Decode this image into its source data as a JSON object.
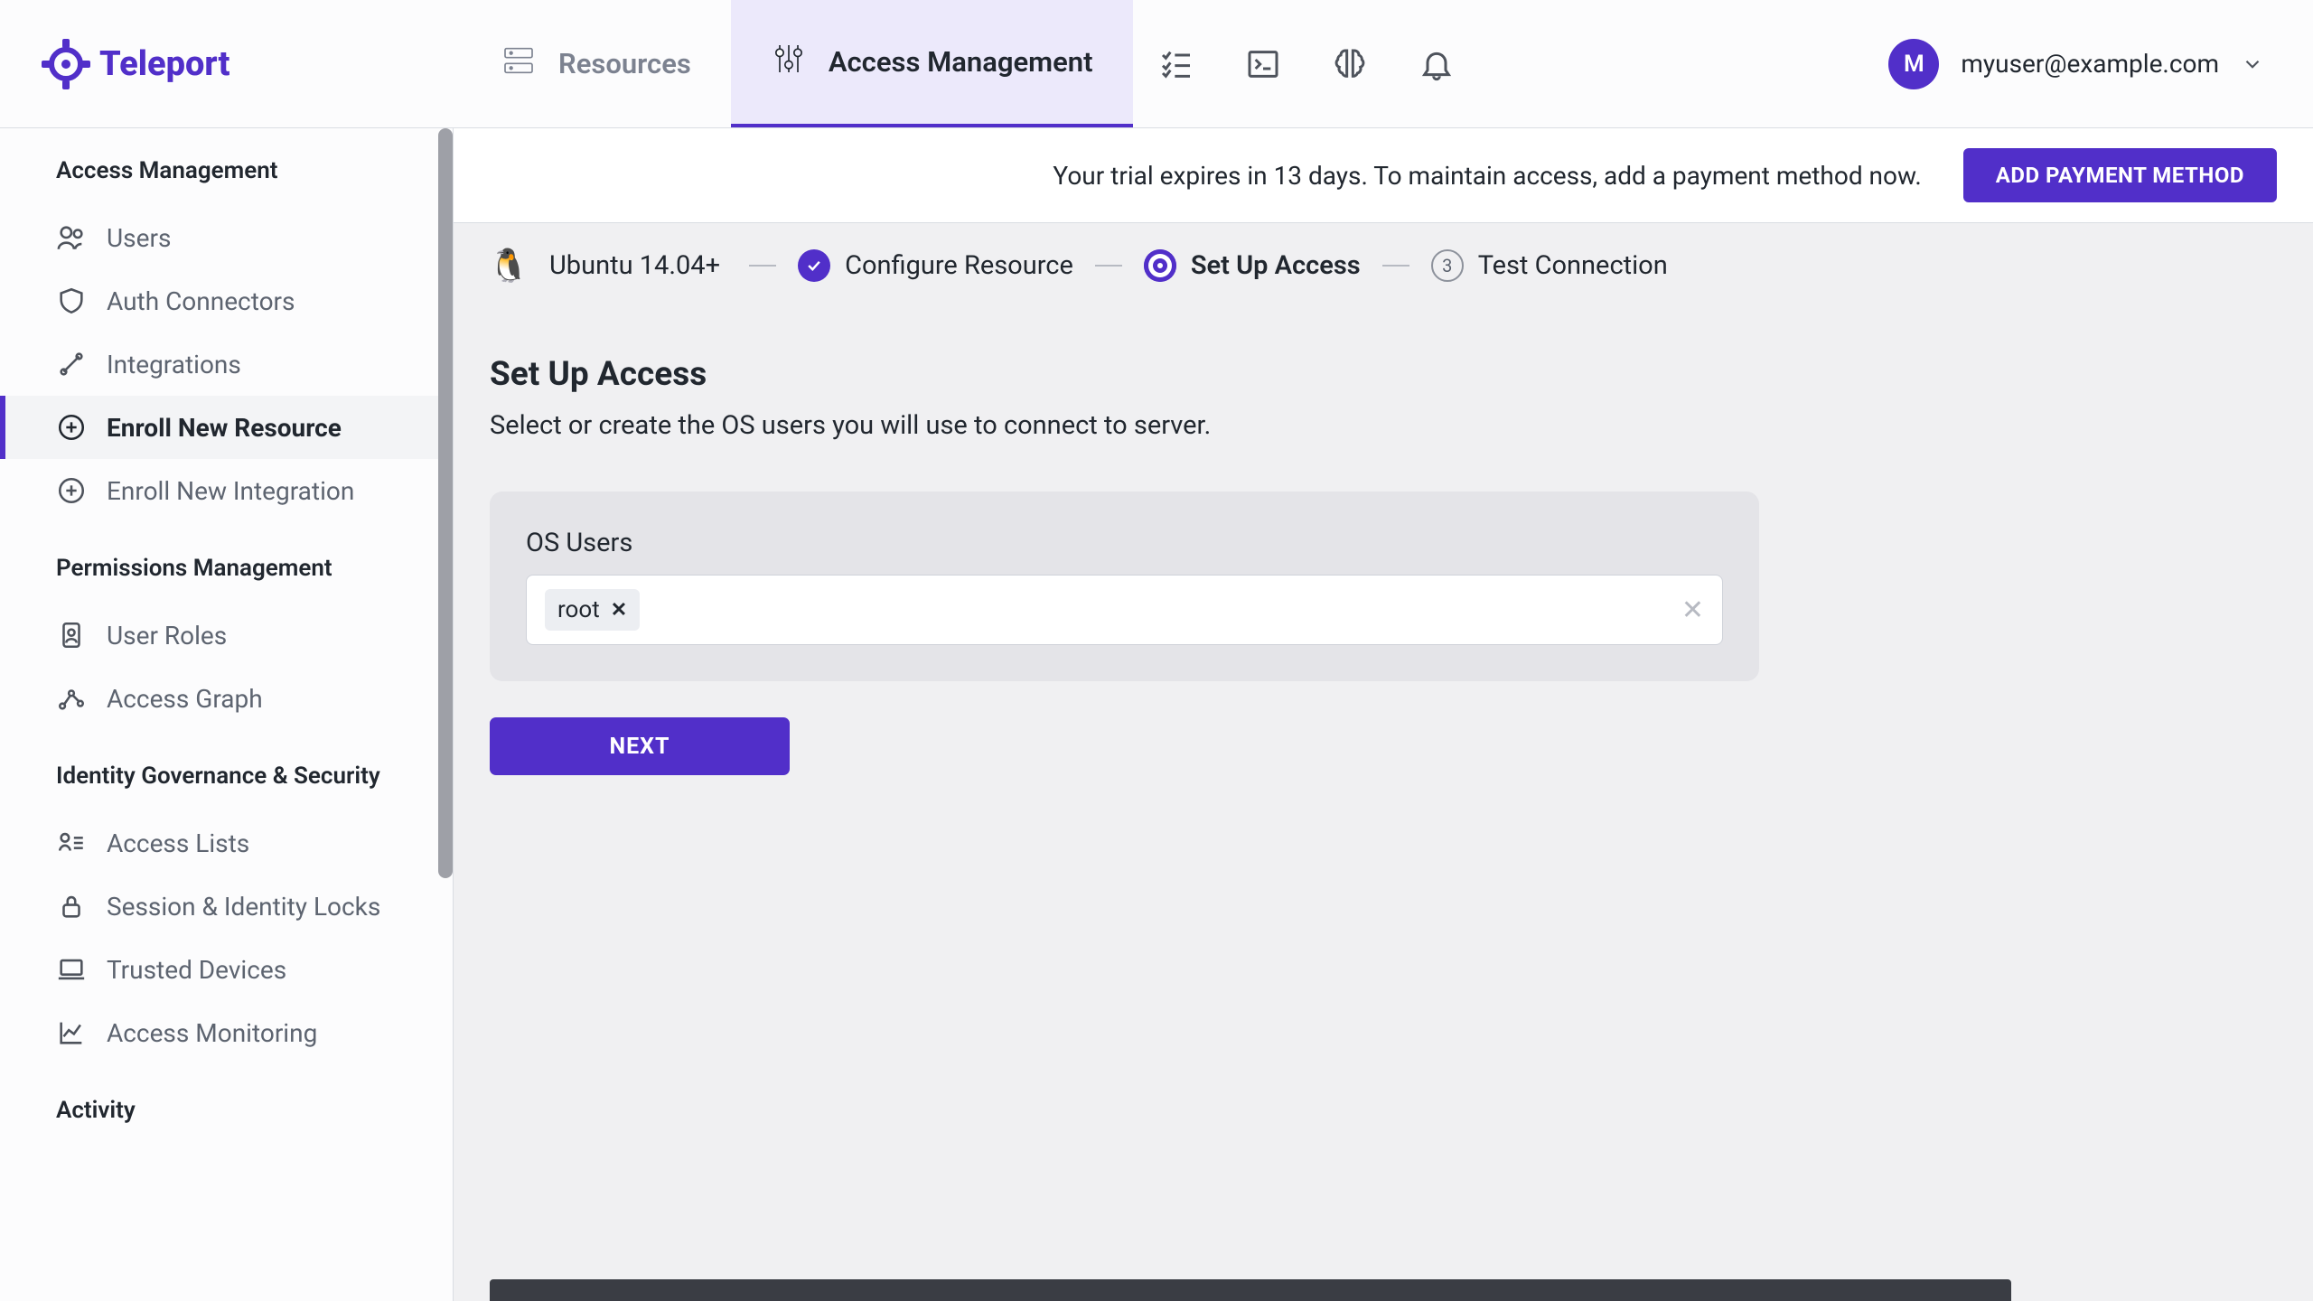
{
  "brand": "Teleport",
  "header": {
    "tabs": [
      {
        "label": "Resources"
      },
      {
        "label": "Access Management"
      }
    ],
    "user": {
      "initial": "M",
      "email": "myuser@example.com"
    }
  },
  "banner": {
    "text": "Your trial expires in 13 days. To maintain access, add a payment method now.",
    "button": "ADD PAYMENT METHOD"
  },
  "sidebar": {
    "sections": [
      {
        "title": "Access Management",
        "items": [
          "Users",
          "Auth Connectors",
          "Integrations",
          "Enroll New Resource",
          "Enroll New Integration"
        ]
      },
      {
        "title": "Permissions Management",
        "items": [
          "User Roles",
          "Access Graph"
        ]
      },
      {
        "title": "Identity Governance & Security",
        "items": [
          "Access Lists",
          "Session & Identity Locks",
          "Trusted Devices",
          "Access Monitoring"
        ]
      },
      {
        "title": "Activity",
        "items": []
      }
    ]
  },
  "stepper": {
    "os": "Ubuntu 14.04+",
    "steps": [
      {
        "label": "Configure Resource"
      },
      {
        "label": "Set Up Access"
      },
      {
        "label": "Test Connection",
        "num": "3"
      }
    ]
  },
  "page": {
    "title": "Set Up Access",
    "subtitle": "Select or create the OS users you will use to connect to server.",
    "os_users_label": "OS Users",
    "tag_value": "root",
    "next": "NEXT"
  }
}
